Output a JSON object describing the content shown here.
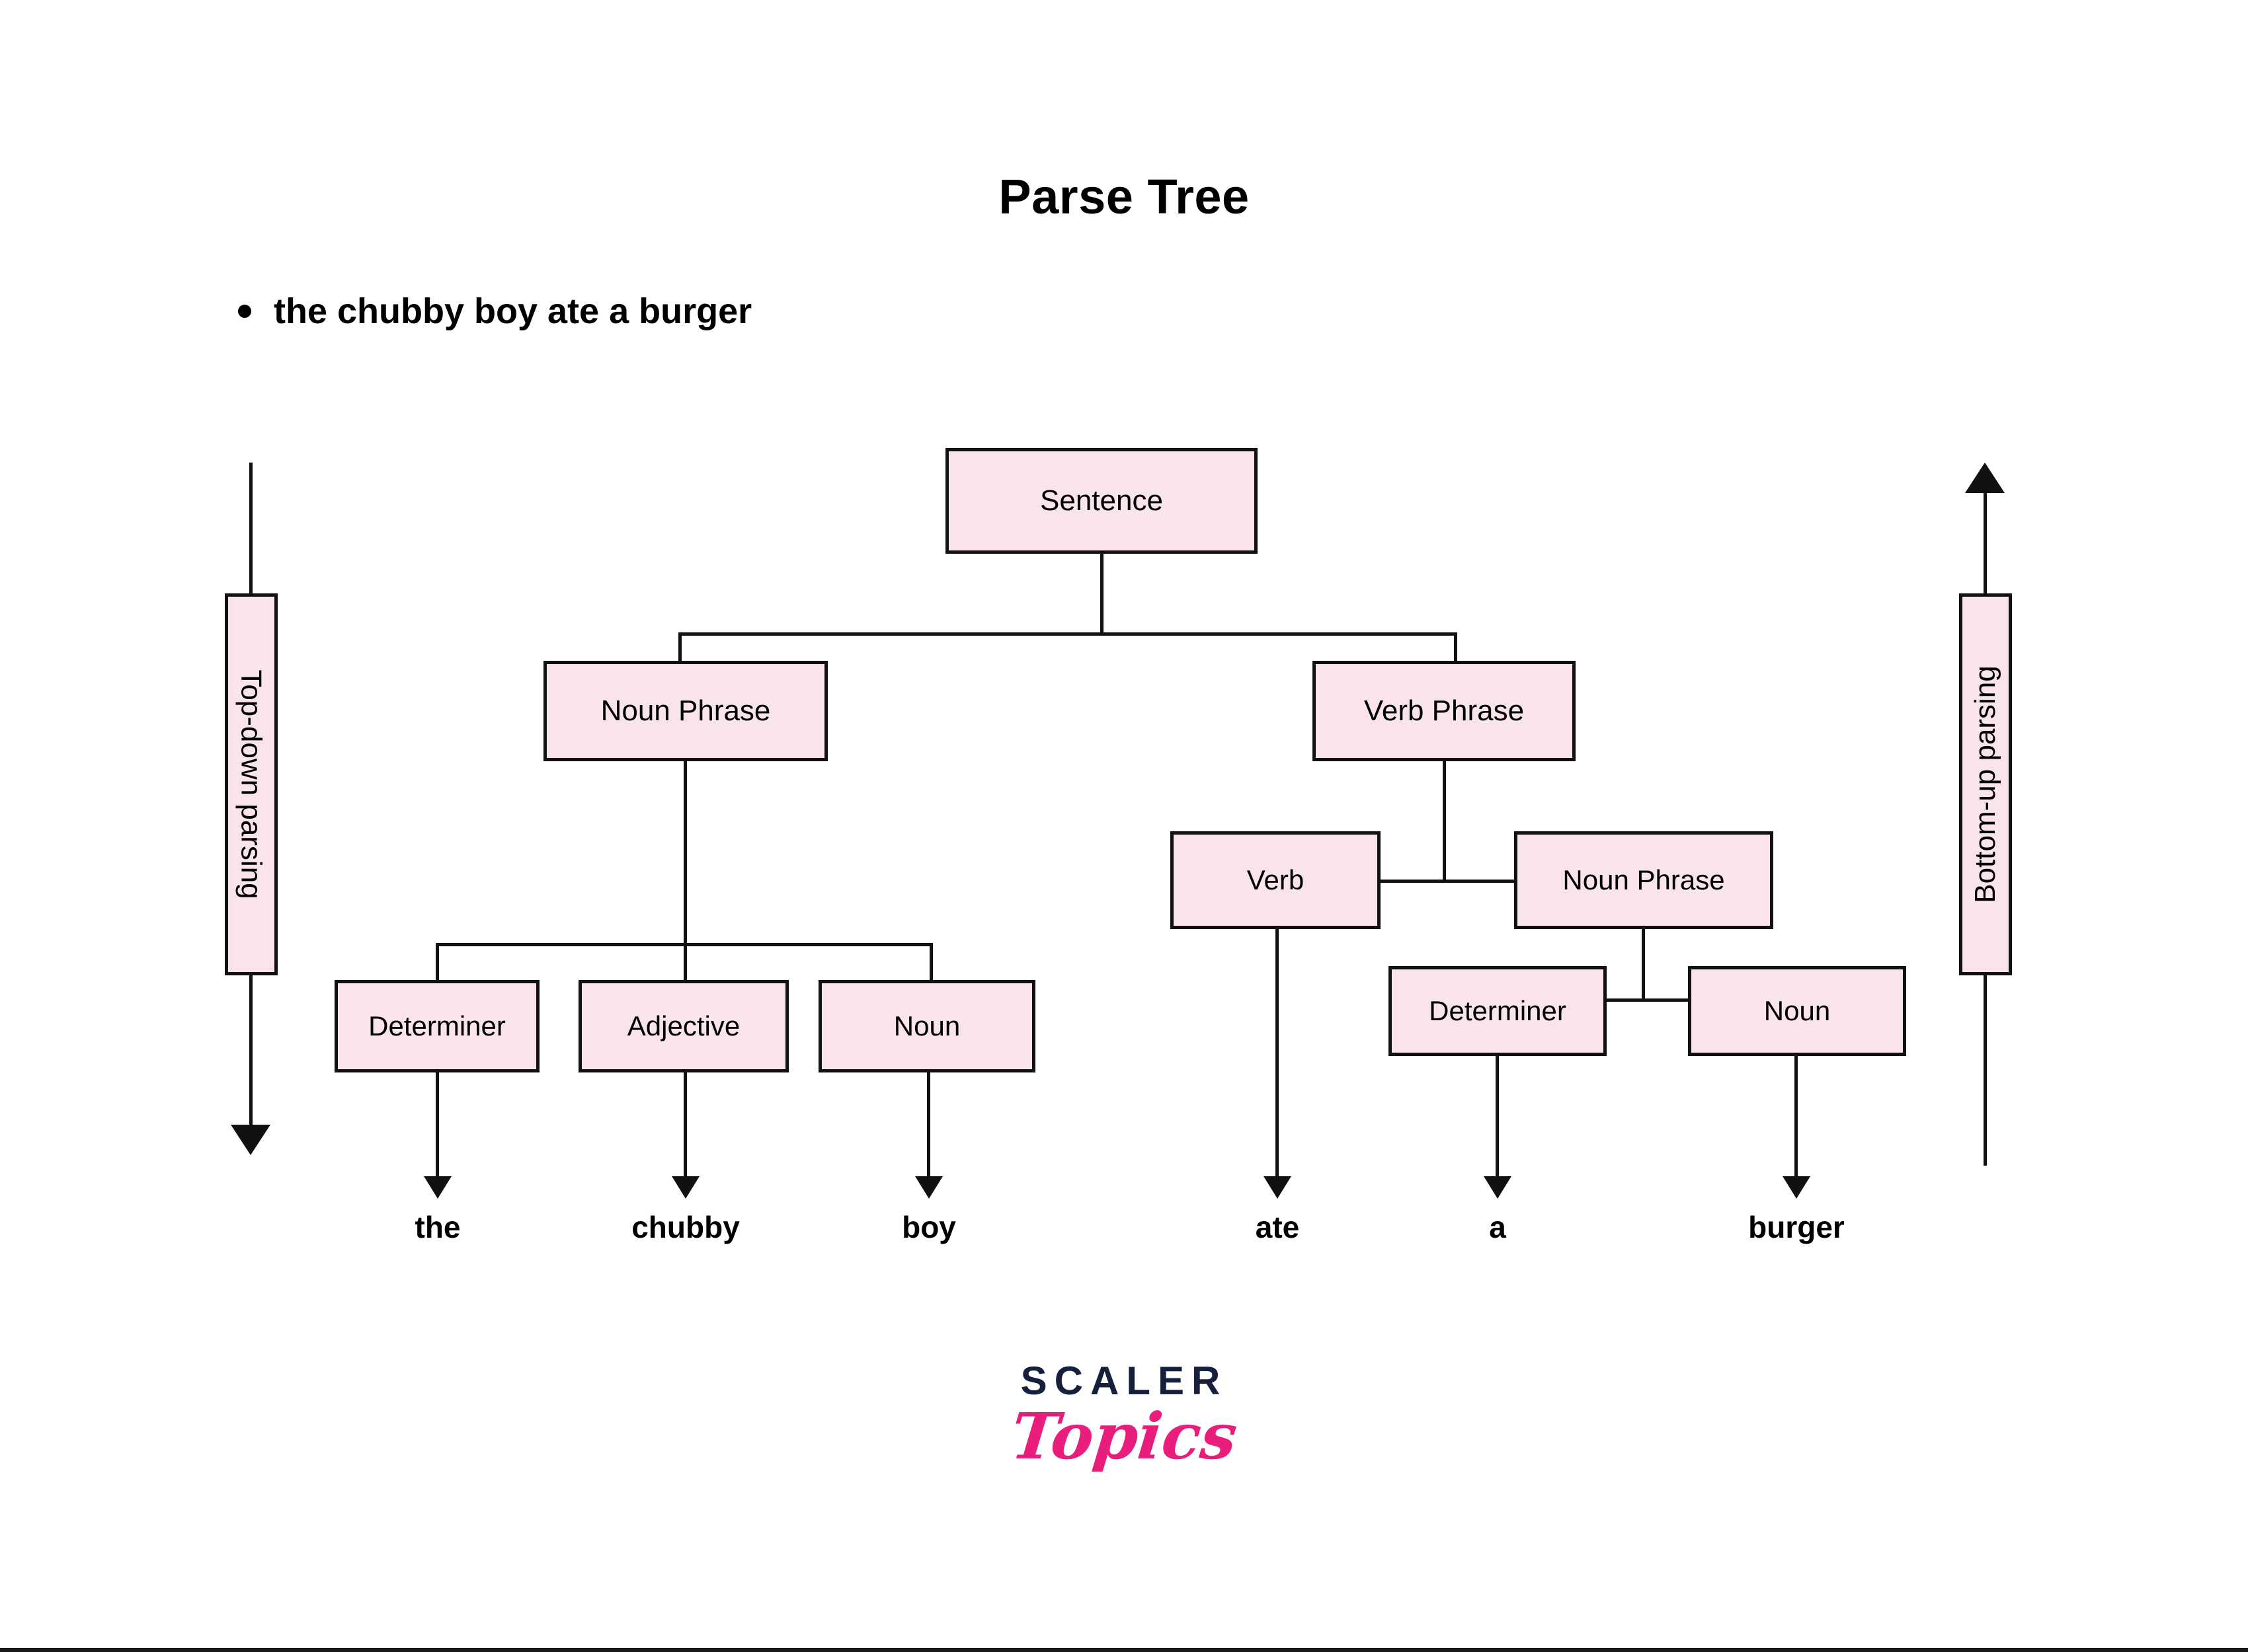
{
  "page": {
    "title": "Parse Tree",
    "background_color": "#ffffff",
    "border_color": "#1a1a1a"
  },
  "colors": {
    "node_fill": "#f9e3ec",
    "node_stroke": "#111111",
    "text": "#000000",
    "logo_dark": "#16203c",
    "logo_pink": "#e91e7c"
  },
  "bullet": {
    "marker": "bullet-dot",
    "text": "the chubby boy ate a burger"
  },
  "side_labels": {
    "left": {
      "text": "Top-down parsing",
      "direction": "down",
      "arrow": "arrow-down-icon"
    },
    "right": {
      "text": "Bottom-up parsing",
      "direction": "up",
      "arrow": "arrow-up-icon"
    }
  },
  "tree": {
    "nodes": [
      {
        "id": "sentence",
        "label": "Sentence"
      },
      {
        "id": "np1",
        "label": "Noun Phrase"
      },
      {
        "id": "vp",
        "label": "Verb Phrase"
      },
      {
        "id": "det1",
        "label": "Determiner"
      },
      {
        "id": "adj",
        "label": "Adjective"
      },
      {
        "id": "noun1",
        "label": "Noun"
      },
      {
        "id": "verb",
        "label": "Verb"
      },
      {
        "id": "np2",
        "label": "Noun Phrase"
      },
      {
        "id": "det2",
        "label": "Determiner"
      },
      {
        "id": "noun2",
        "label": "Noun"
      }
    ],
    "edges": [
      {
        "from": "sentence",
        "to": "np1"
      },
      {
        "from": "sentence",
        "to": "vp"
      },
      {
        "from": "np1",
        "to": "det1"
      },
      {
        "from": "np1",
        "to": "adj"
      },
      {
        "from": "np1",
        "to": "noun1"
      },
      {
        "from": "vp",
        "to": "verb"
      },
      {
        "from": "vp",
        "to": "np2"
      },
      {
        "from": "np2",
        "to": "det2"
      },
      {
        "from": "np2",
        "to": "noun2"
      }
    ],
    "leaves": [
      {
        "id": "leaf-the",
        "parent": "det1",
        "word": "the"
      },
      {
        "id": "leaf-chubby",
        "parent": "adj",
        "word": "chubby"
      },
      {
        "id": "leaf-boy",
        "parent": "noun1",
        "word": "boy"
      },
      {
        "id": "leaf-ate",
        "parent": "verb",
        "word": "ate"
      },
      {
        "id": "leaf-a",
        "parent": "det2",
        "word": "a"
      },
      {
        "id": "leaf-burger",
        "parent": "noun2",
        "word": "burger"
      }
    ]
  },
  "logo": {
    "primary": "SCALER",
    "secondary": "Topics"
  }
}
